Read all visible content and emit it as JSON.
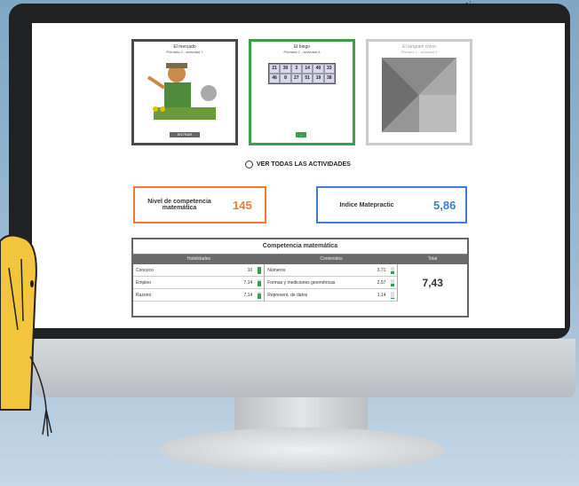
{
  "cards": [
    {
      "title": "El mercado",
      "subtitle": "Primaria 2 - actividad 7",
      "pill": "ENTRAR"
    },
    {
      "title": "El bingo",
      "subtitle": "Primaria 2 - actividad 8",
      "pill": "→"
    },
    {
      "title": "El tangram chino",
      "subtitle": "Primaria 2 - actividad 9"
    }
  ],
  "bingo_numbers": [
    "21",
    "30",
    "3",
    "14",
    "40",
    "33",
    "46",
    "8",
    "27",
    "51",
    "19",
    "38"
  ],
  "see_all": "VER TODAS LAS ACTIVIDADES",
  "competencia": {
    "label": "Nivel de competencia matemática",
    "value": "145",
    "color": "#f07b2f"
  },
  "indice": {
    "label": "Indice Matepractic",
    "value": "5,86",
    "color": "#3c7fd0"
  },
  "table": {
    "title": "Competencia matemática",
    "headers": [
      "Habilidades",
      "Contenidos",
      "Total"
    ],
    "habilidades": [
      {
        "name": "Conozco",
        "value": "10",
        "fill": 1.0
      },
      {
        "name": "Empleo",
        "value": "7,14",
        "fill": 0.71
      },
      {
        "name": "Razono",
        "value": "7,14",
        "fill": 0.71
      }
    ],
    "contenidos": [
      {
        "name": "Números",
        "value": "3,71",
        "fill": 0.37
      },
      {
        "name": "Formas y mediciones geométricas",
        "value": "2,57",
        "fill": 0.26
      },
      {
        "name": "Represent. de datos",
        "value": "1,14",
        "fill": 0.11
      }
    ],
    "total": "7,43"
  }
}
